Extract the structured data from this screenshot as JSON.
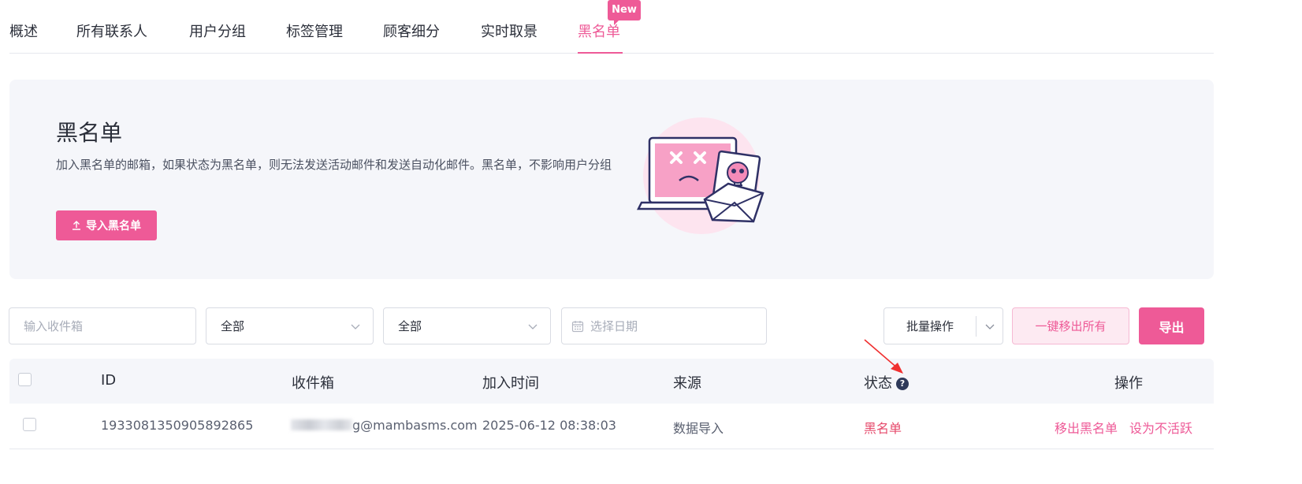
{
  "tabs": [
    {
      "label": "概述"
    },
    {
      "label": "所有联系人"
    },
    {
      "label": "用户分组"
    },
    {
      "label": "标签管理"
    },
    {
      "label": "顾客细分"
    },
    {
      "label": "实时取景"
    },
    {
      "label": "黑名单",
      "badge": "New"
    }
  ],
  "hero": {
    "title": "黑名单",
    "description": "加入黑名单的邮箱，如果状态为黑名单，则无法发送活动邮件和发送自动化邮件。黑名单，不影响用户分组",
    "import_button": "导入黑名单"
  },
  "filters": {
    "inbox_placeholder": "输入收件箱",
    "select1_value": "全部",
    "select2_value": "全部",
    "date_placeholder": "选择日期"
  },
  "actions": {
    "batch": "批量操作",
    "remove_all": "一键移出所有",
    "export": "导出"
  },
  "table": {
    "headers": {
      "id": "ID",
      "inbox": "收件箱",
      "added": "加入时间",
      "source": "来源",
      "status": "状态",
      "ops": "操作"
    },
    "rows": [
      {
        "id": "1933081350905892865",
        "inbox_suffix": "g@mambasms.com",
        "added": "2025-06-12 08:38:03",
        "source": "数据导入",
        "status": "黑名单",
        "op_remove": "移出黑名单",
        "op_inactive": "设为不活跃"
      }
    ]
  },
  "colors": {
    "accent": "#ee5a97",
    "status_red": "#e64a6b"
  }
}
